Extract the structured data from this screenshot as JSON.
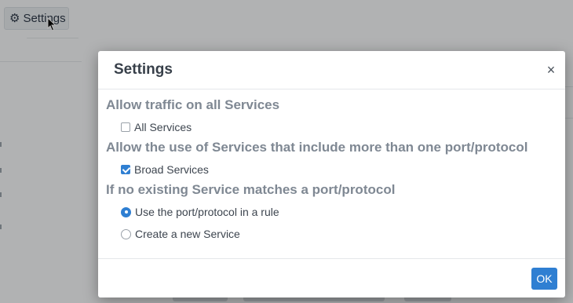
{
  "background": {
    "settings_button_label": "Settings"
  },
  "modal": {
    "title": "Settings",
    "close_symbol": "×",
    "sections": [
      {
        "title": "Allow traffic on all Services",
        "option": {
          "type": "checkbox",
          "label": "All Services",
          "checked": false
        }
      },
      {
        "title": "Allow the use of Services that include more than one port/protocol",
        "option": {
          "type": "checkbox",
          "label": "Broad Services",
          "checked": true
        }
      },
      {
        "title": "If no existing Service matches a port/protocol",
        "options": [
          {
            "type": "radio",
            "label": "Use the port/protocol in a rule",
            "checked": true
          },
          {
            "type": "radio",
            "label": "Create a new Service",
            "checked": false
          }
        ]
      }
    ],
    "ok_label": "OK"
  },
  "colors": {
    "accent": "#2f7fd2",
    "section_title": "#7f8893",
    "overlay": "rgba(0,0,0,0.28)"
  },
  "icons": {
    "settings": "gear-icon",
    "close": "close-icon",
    "pointer": "cursor-icon"
  }
}
